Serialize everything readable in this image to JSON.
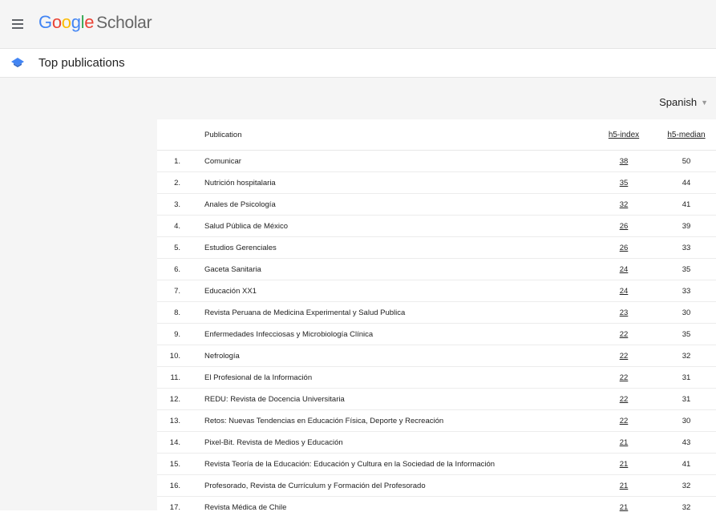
{
  "header": {
    "logo_google": [
      "G",
      "o",
      "o",
      "g",
      "l",
      "e"
    ],
    "logo_colors": [
      "#4285F4",
      "#EA4335",
      "#FBBC05",
      "#4285F4",
      "#34A853",
      "#EA4335"
    ],
    "logo_scholar": "Scholar"
  },
  "page": {
    "title": "Top publications",
    "language": "Spanish"
  },
  "table": {
    "headers": {
      "publication": "Publication",
      "h5_index": "h5-index",
      "h5_median": "h5-median"
    },
    "rows": [
      {
        "rank": "1.",
        "publication": "Comunicar",
        "h5_index": "38",
        "h5_median": "50"
      },
      {
        "rank": "2.",
        "publication": "Nutrición hospitalaria",
        "h5_index": "35",
        "h5_median": "44"
      },
      {
        "rank": "3.",
        "publication": "Anales de Psicología",
        "h5_index": "32",
        "h5_median": "41"
      },
      {
        "rank": "4.",
        "publication": "Salud Pública de México",
        "h5_index": "26",
        "h5_median": "39"
      },
      {
        "rank": "5.",
        "publication": "Estudios Gerenciales",
        "h5_index": "26",
        "h5_median": "33"
      },
      {
        "rank": "6.",
        "publication": "Gaceta Sanitaria",
        "h5_index": "24",
        "h5_median": "35"
      },
      {
        "rank": "7.",
        "publication": "Educación XX1",
        "h5_index": "24",
        "h5_median": "33"
      },
      {
        "rank": "8.",
        "publication": "Revista Peruana de Medicina Experimental y Salud Publica",
        "h5_index": "23",
        "h5_median": "30"
      },
      {
        "rank": "9.",
        "publication": "Enfermedades Infecciosas y Microbiología Clínica",
        "h5_index": "22",
        "h5_median": "35"
      },
      {
        "rank": "10.",
        "publication": "Nefrología",
        "h5_index": "22",
        "h5_median": "32"
      },
      {
        "rank": "11.",
        "publication": "El Profesional de la Información",
        "h5_index": "22",
        "h5_median": "31"
      },
      {
        "rank": "12.",
        "publication": "REDU: Revista de Docencia Universitaria",
        "h5_index": "22",
        "h5_median": "31"
      },
      {
        "rank": "13.",
        "publication": "Retos: Nuevas Tendencias en Educación Física, Deporte y Recreación",
        "h5_index": "22",
        "h5_median": "30"
      },
      {
        "rank": "14.",
        "publication": "Pixel-Bit. Revista de Medios y Educación",
        "h5_index": "21",
        "h5_median": "43"
      },
      {
        "rank": "15.",
        "publication": "Revista Teoría de la Educación: Educación y Cultura en la Sociedad de la Información",
        "h5_index": "21",
        "h5_median": "41"
      },
      {
        "rank": "16.",
        "publication": "Profesorado, Revista de Currículum y Formación del Profesorado",
        "h5_index": "21",
        "h5_median": "32"
      },
      {
        "rank": "17.",
        "publication": "Revista Médica de Chile",
        "h5_index": "21",
        "h5_median": "32"
      }
    ]
  }
}
